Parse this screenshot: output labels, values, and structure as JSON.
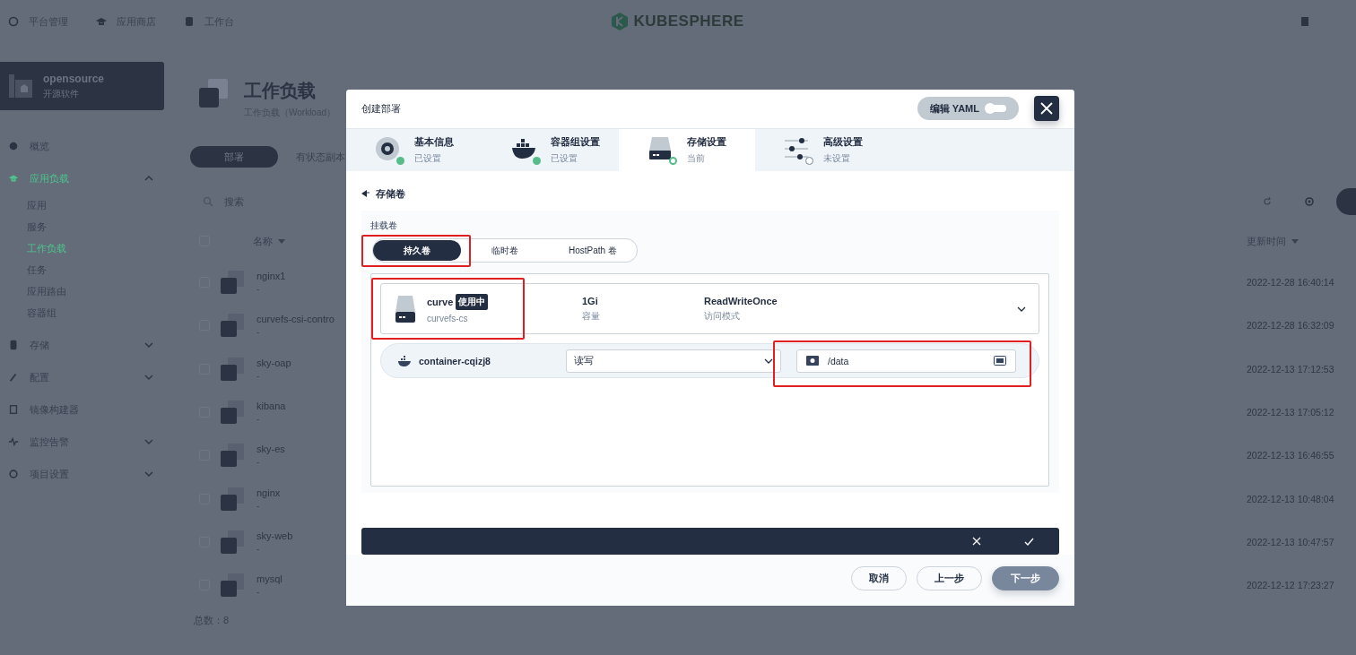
{
  "top_nav": [
    {
      "label": "平台管理"
    },
    {
      "label": "应用商店"
    },
    {
      "label": "工作台"
    }
  ],
  "logo": {
    "text": "KUBESPHERE"
  },
  "workspace": {
    "name": "opensource",
    "subtitle": "开源软件"
  },
  "sidebar": {
    "items": [
      {
        "label": "概览",
        "selected": false
      },
      {
        "label": "应用负载",
        "selected": true,
        "expanded": true,
        "children": [
          {
            "label": "应用",
            "selected": false
          },
          {
            "label": "服务",
            "selected": false
          },
          {
            "label": "工作负载",
            "selected": true
          },
          {
            "label": "任务",
            "selected": false
          },
          {
            "label": "应用路由",
            "selected": false
          },
          {
            "label": "容器组",
            "selected": false
          }
        ]
      },
      {
        "label": "存储",
        "selected": false,
        "expanded": false
      },
      {
        "label": "配置",
        "selected": false,
        "expanded": false
      },
      {
        "label": "镜像构建器",
        "selected": false
      },
      {
        "label": "监控告警",
        "selected": false,
        "expanded": false
      },
      {
        "label": "项目设置",
        "selected": false,
        "expanded": false
      }
    ]
  },
  "page_header": {
    "title": "工作负载",
    "description": "工作负载（Workload）"
  },
  "tabs": [
    {
      "label": "部署",
      "selected": true
    },
    {
      "label": "有状态副本",
      "selected": false
    }
  ],
  "search": {
    "placeholder": "搜索"
  },
  "table": {
    "columns": [
      "名称",
      "更新时间"
    ],
    "all_checked": false,
    "rows": [
      {
        "checked": false,
        "name": "nginx1",
        "description": "-",
        "updated": "2022-12-28 16:40:14"
      },
      {
        "checked": false,
        "name": "curvefs-csi-contro",
        "description": "-",
        "updated": "2022-12-28 16:32:09"
      },
      {
        "checked": false,
        "name": "sky-oap",
        "description": "-",
        "updated": "2022-12-13 17:12:53"
      },
      {
        "checked": false,
        "name": "kibana",
        "description": "-",
        "updated": "2022-12-13 17:05:12"
      },
      {
        "checked": false,
        "name": "sky-es",
        "description": "-",
        "updated": "2022-12-13 16:46:55"
      },
      {
        "checked": false,
        "name": "nginx",
        "description": "-",
        "updated": "2022-12-13 10:48:04"
      },
      {
        "checked": false,
        "name": "sky-web",
        "description": "-",
        "updated": "2022-12-13 10:47:57"
      },
      {
        "checked": false,
        "name": "mysql",
        "description": "-",
        "updated": "2022-12-12 17:23:27"
      }
    ]
  },
  "total": "总数：8",
  "modal": {
    "title": "创建部署",
    "yaml_button": "编辑 YAML",
    "yaml_on": false,
    "steps": [
      {
        "title": "基本信息",
        "status_text": "已设置",
        "completed": true,
        "selected": false
      },
      {
        "title": "容器组设置",
        "status_text": "已设置",
        "completed": true,
        "selected": false
      },
      {
        "title": "存储设置",
        "status_text": "当前",
        "completed": false,
        "selected": true
      },
      {
        "title": "高级设置",
        "status_text": "未设置",
        "completed": false,
        "selected": false
      }
    ],
    "back_label": "存储卷",
    "volume_group_label": "挂载卷",
    "volume_types": [
      {
        "label": "持久卷",
        "selected": true,
        "highlighted": true
      },
      {
        "label": "临时卷",
        "selected": false,
        "highlighted": false
      },
      {
        "label": "HostPath 卷",
        "selected": false,
        "highlighted": false
      }
    ],
    "volume": {
      "name": "curve",
      "badge": "使用中",
      "storage_class": "curvefs-cs",
      "capacity": "1Gi",
      "capacity_label": "容量",
      "access_mode": "ReadWriteOnce",
      "access_mode_label": "访问模式",
      "highlighted": true
    },
    "mount": {
      "container": "container-cqizj8",
      "mode": "读写",
      "path": "/data",
      "highlighted": true
    },
    "buttons": [
      {
        "label": "取消",
        "kind": "secondary"
      },
      {
        "label": "上一步",
        "kind": "secondary"
      },
      {
        "label": "下一步",
        "kind": "primary"
      }
    ]
  }
}
